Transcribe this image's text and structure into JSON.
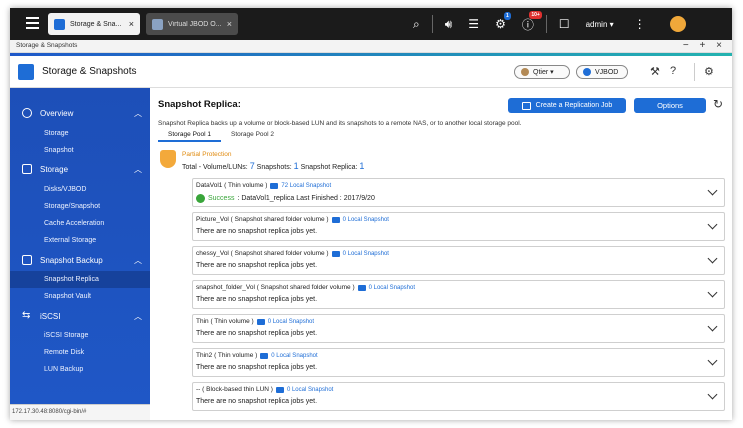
{
  "topbar": {
    "tabs": [
      {
        "label": "Storage & Sna...",
        "icon": "storage-icon"
      },
      {
        "label": "Virtual JBOD O...",
        "icon": "vjbod-icon"
      }
    ],
    "badges": {
      "tasks": "1",
      "notifications": "10+"
    },
    "user": "admin ▾"
  },
  "window": {
    "title": "Storage & Snapshots",
    "controls": "− + ×"
  },
  "app": {
    "title": "Storage & Snapshots",
    "qtier_label": "Qtier ▾",
    "vjbod_label": "VJBOD"
  },
  "sidebar": {
    "sections": [
      {
        "label": "Overview",
        "items": [
          "Storage",
          "Snapshot"
        ]
      },
      {
        "label": "Storage",
        "items": [
          "Disks/VJBOD",
          "Storage/Snapshot",
          "Cache Acceleration",
          "External Storage"
        ]
      },
      {
        "label": "Snapshot Backup",
        "items": [
          "Snapshot Replica",
          "Snapshot Vault"
        ]
      },
      {
        "label": "iSCSI",
        "items": [
          "iSCSI Storage",
          "Remote Disk",
          "LUN Backup"
        ]
      }
    ],
    "active_item": "Snapshot Replica"
  },
  "status_url": "172.17.30.48:8080/cgi-bin/#",
  "main": {
    "title": "Snapshot Replica:",
    "create_button": "Create a Replication Job",
    "options_button": "Options",
    "description": "Snapshot Replica backs up a volume or block-based LUN and its snapshots to a remote NAS, or to another local storage pool.",
    "pool_tabs": [
      "Storage Pool 1",
      "Storage Pool 2"
    ],
    "protection": {
      "title": "Partial Protection",
      "total_label": "Total - Volume/LUNs:",
      "total_value": "7",
      "snapshots_label": "Snapshots:",
      "snapshots_value": "1",
      "replica_label": "Snapshot Replica:",
      "replica_value": "1"
    },
    "volumes": [
      {
        "name": "DataVol1 ( Thin volume )",
        "snapshot": "72 Local Snapshot",
        "success": "Success",
        "detail": ": DataVol1_replica Last Finished : 2017/9/20"
      },
      {
        "name": "Picture_Vol ( Snapshot shared folder volume )",
        "snapshot": "0 Local Snapshot",
        "detail": "There are no snapshot replica jobs yet."
      },
      {
        "name": "chessy_Vol ( Snapshot shared folder volume )",
        "snapshot": "0 Local Snapshot",
        "detail": "There are no snapshot replica jobs yet."
      },
      {
        "name": "snapshot_folder_Vol ( Snapshot shared folder volume )",
        "snapshot": "0 Local Snapshot",
        "detail": "There are no snapshot replica jobs yet."
      },
      {
        "name": "Thin ( Thin volume )",
        "snapshot": "0 Local Snapshot",
        "detail": "There are no snapshot replica jobs yet."
      },
      {
        "name": "Thin2 ( Thin volume )",
        "snapshot": "0 Local Snapshot",
        "detail": "There are no snapshot replica jobs yet."
      },
      {
        "name": "-- ( Block-based thin LUN )",
        "snapshot": "0 Local Snapshot",
        "detail": "There are no snapshot replica jobs yet."
      }
    ]
  },
  "colors": {
    "accent": "#1e6dd6",
    "sidebar": "#1f57c6",
    "success": "#39a53a",
    "warning": "#f3a93b"
  }
}
